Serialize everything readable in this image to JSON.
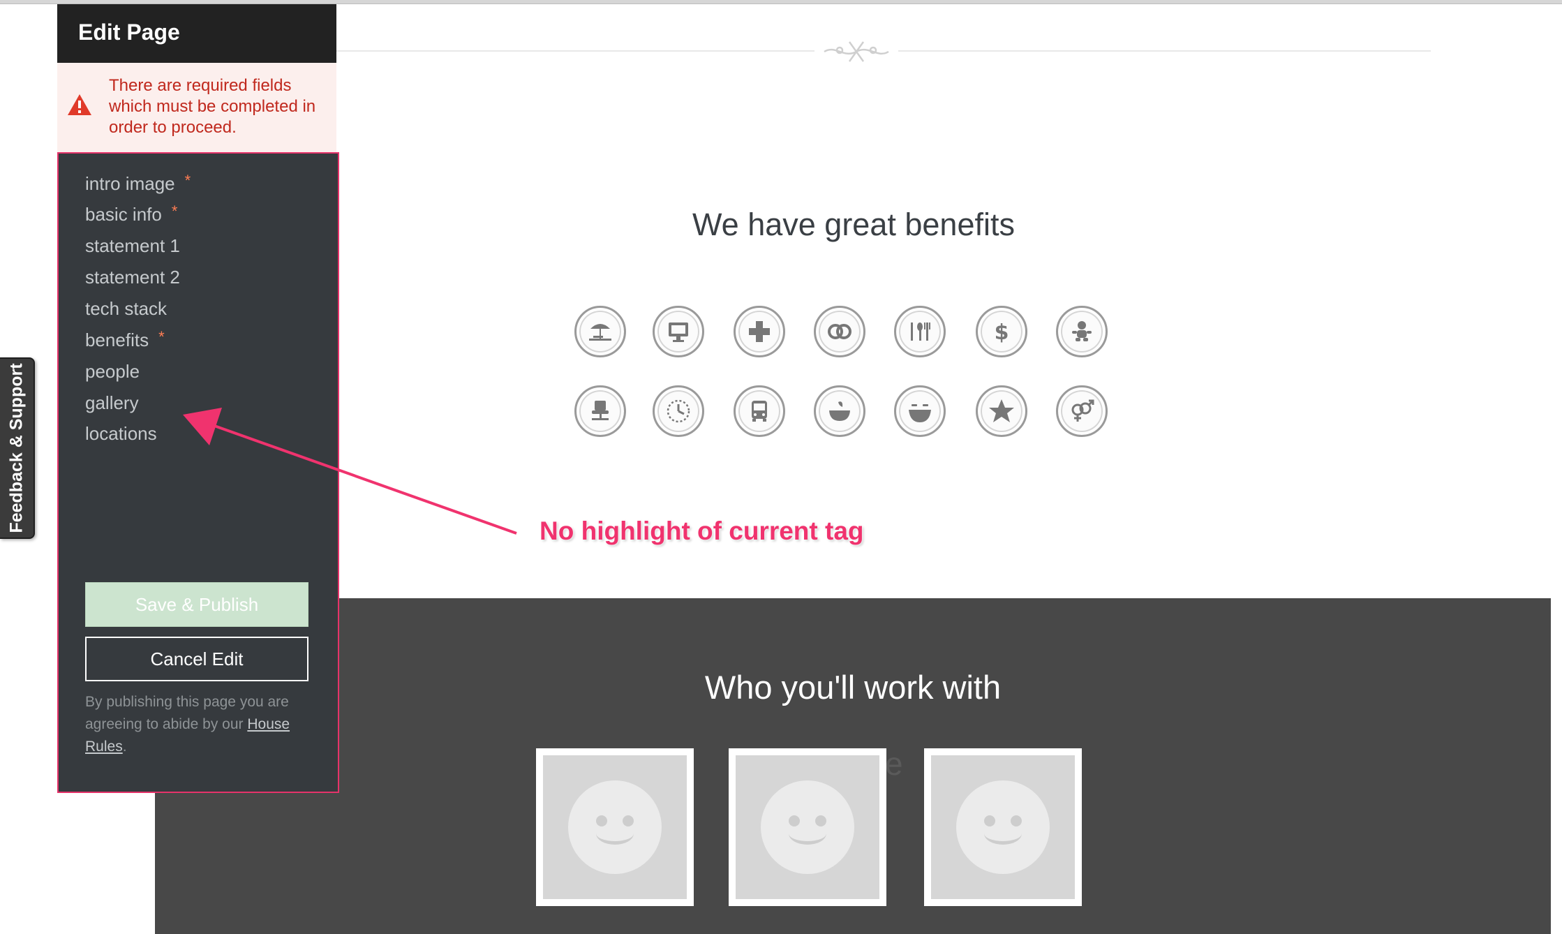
{
  "edit_panel": {
    "title": "Edit Page",
    "error_message": "There are required fields which must be completed in order to proceed.",
    "nav_items": [
      {
        "label": "intro image",
        "required": true
      },
      {
        "label": "basic info",
        "required": true
      },
      {
        "label": "statement 1",
        "required": false
      },
      {
        "label": "statement 2",
        "required": false
      },
      {
        "label": "tech stack",
        "required": false
      },
      {
        "label": "benefits",
        "required": true
      },
      {
        "label": "people",
        "required": false
      },
      {
        "label": "gallery",
        "required": false
      },
      {
        "label": "locations",
        "required": false
      }
    ],
    "required_marker": "*",
    "save_label": "Save & Publish",
    "cancel_label": "Cancel Edit",
    "terms_text": "By publishing this page you are agreeing to abide by our",
    "terms_link": "House Rules",
    "terms_end": "."
  },
  "feedback_tab": {
    "label": "Feedback & Support"
  },
  "benefits": {
    "title": "We have great benefits",
    "icons": [
      "beach-vacation-icon",
      "computer-monitor-icon",
      "health-cross-icon",
      "gym-icon",
      "food-dining-icon",
      "money-dollar-icon",
      "baby-childcare-icon",
      "office-chair-icon",
      "clock-flex-time-icon",
      "bus-commute-icon",
      "snack-bowl-icon",
      "fun-smile-icon",
      "star-perks-icon",
      "gender-equality-icon"
    ]
  },
  "people_section": {
    "title": "Who you'll work with",
    "ghost_text": "People"
  },
  "annotation": {
    "text": "No highlight of current tag"
  },
  "colors": {
    "annotation": "#f0336e",
    "panel_background": "#363a3e",
    "error_text": "#c0281d",
    "save_button": "#cce4cf",
    "people_background": "#484848"
  }
}
